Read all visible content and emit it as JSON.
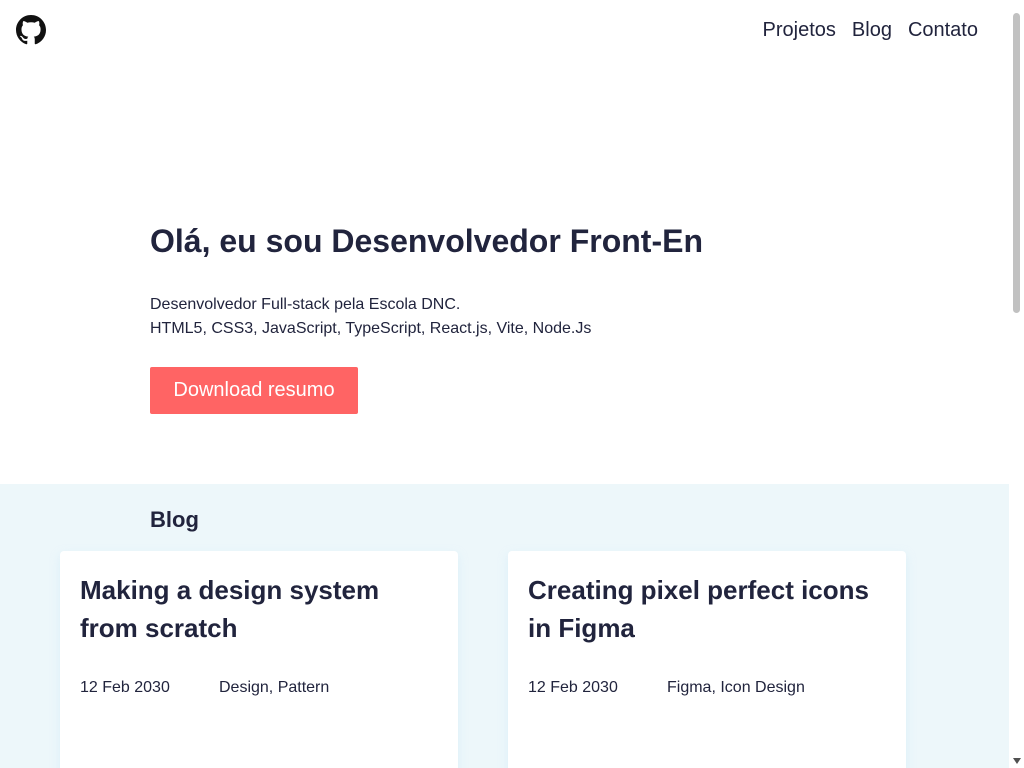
{
  "header": {
    "logo_icon": "github-icon",
    "nav": [
      {
        "label": "Projetos"
      },
      {
        "label": "Blog"
      },
      {
        "label": "Contato"
      }
    ]
  },
  "hero": {
    "title": "Olá, eu sou Desenvolvedor Front-En",
    "desc_line1": "Desenvolvedor Full-stack pela Escola DNC.",
    "desc_line2": "HTML5, CSS3, JavaScript, TypeScript, React.js, Vite, Node.Js",
    "download_label": "Download resumo"
  },
  "blog": {
    "heading": "Blog",
    "posts": [
      {
        "title": "Making a design system from scratch",
        "date": "12 Feb 2030",
        "tags": "Design, Pattern"
      },
      {
        "title": "Creating pixel perfect icons in Figma",
        "date": "12 Feb 2030",
        "tags": "Figma, Icon Design"
      }
    ]
  },
  "colors": {
    "accent": "#ff6464",
    "text": "#21243d",
    "section_bg": "#edf7fa"
  }
}
